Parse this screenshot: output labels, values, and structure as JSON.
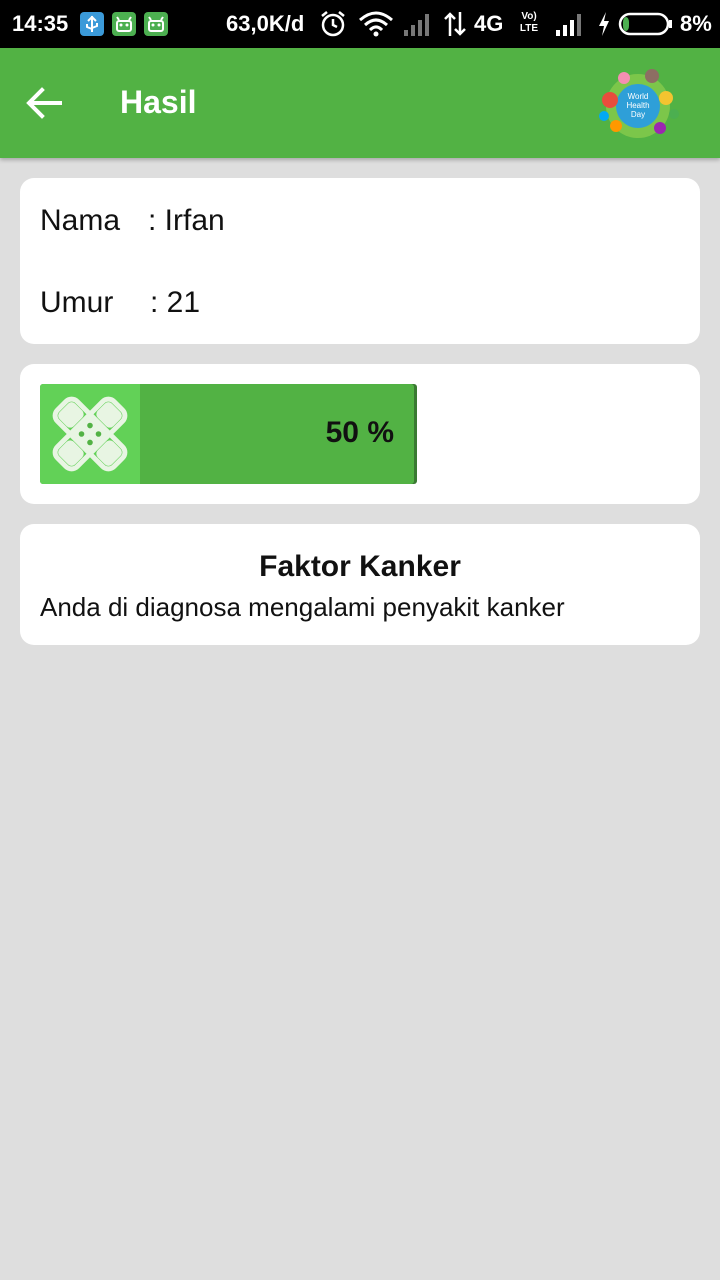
{
  "status_bar": {
    "time": "14:35",
    "speed": "63,0K/d",
    "network": "4G",
    "volte_top": "Vo)",
    "volte_bottom": "LTE",
    "battery_percent": "8%",
    "icons": [
      "usb-icon",
      "android-icon",
      "android-icon",
      "alarm-icon",
      "wifi-icon",
      "signal-icon",
      "data-arrows-icon",
      "volte-icon",
      "signal-icon",
      "charging-icon",
      "battery-icon"
    ]
  },
  "appbar": {
    "title": "Hasil",
    "back_icon": "arrow-left-icon",
    "logo_text_1": "World",
    "logo_text_2": "Health",
    "logo_text_3": "Day"
  },
  "info": {
    "name_label": "Nama",
    "name_value": ": Irfan",
    "age_label": "Umur",
    "age_value": ": 21"
  },
  "progress": {
    "value_percent": 50,
    "label": "50 %",
    "icon": "bandage-icon"
  },
  "result": {
    "title": "Faktor Kanker",
    "description": "Anda di diagnosa mengalami penyakit kanker"
  },
  "colors": {
    "primary": "#52b244",
    "icon_bg": "#62d157",
    "background": "#dedede"
  }
}
